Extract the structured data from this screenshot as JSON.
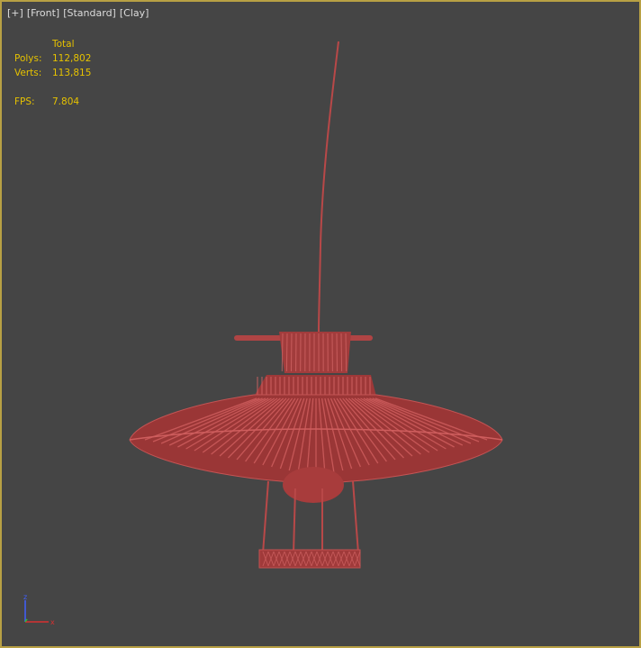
{
  "viewport": {
    "label_parts": [
      "[+]",
      "[Front]",
      "[Standard]",
      "[Clay]"
    ],
    "border_color": "#b8a044",
    "background_color": "#454545"
  },
  "stats": {
    "header": "Total",
    "polys_label": "Polys:",
    "polys_value": "112,802",
    "verts_label": "Verts:",
    "verts_value": "113,815",
    "fps_label": "FPS:",
    "fps_value": "7.804",
    "text_color": "#e6c200"
  },
  "model": {
    "name": "rattan-pendant-lamp",
    "clay_color": "#b84848"
  },
  "axis_gizmo": {
    "x_label": "x",
    "z_label": "z",
    "x_color": "#d83030",
    "y_color": "#30c030",
    "z_color": "#4060ff"
  }
}
